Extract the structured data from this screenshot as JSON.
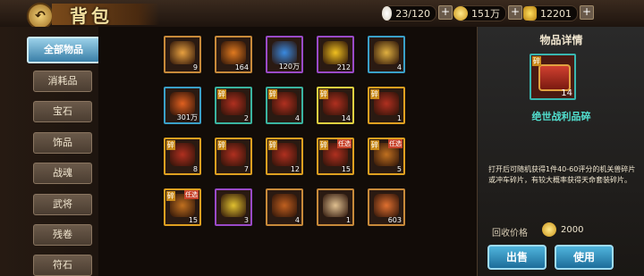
{
  "header": {
    "back_icon": "back-arrow-icon",
    "title": "背包"
  },
  "resources": [
    {
      "name": "rice",
      "icon": "rice-icon",
      "value": "23/120"
    },
    {
      "name": "coin",
      "icon": "coin-icon",
      "value": "151万"
    },
    {
      "name": "gold",
      "icon": "gold-ingot-icon",
      "value": "12201"
    }
  ],
  "plus_label": "+",
  "sidebar": {
    "items": [
      {
        "label": "全部物品",
        "active": true
      },
      {
        "label": "消耗品"
      },
      {
        "label": "宝石"
      },
      {
        "label": "饰品"
      },
      {
        "label": "战魂"
      },
      {
        "label": "武将"
      },
      {
        "label": "残卷"
      },
      {
        "label": "符石"
      }
    ]
  },
  "inventory": [
    {
      "icon": "gem-crystal-icon",
      "count": "9",
      "frame": "#c88a3a",
      "color": "#e7a040"
    },
    {
      "icon": "orange-orb-icon",
      "count": "164",
      "frame": "#c88a3a",
      "color": "#e07a20"
    },
    {
      "icon": "blue-gem-icon",
      "count": "120万",
      "frame": "#9a4ac8",
      "color": "#3a8ae0"
    },
    {
      "icon": "gold-coin-icon",
      "count": "212",
      "frame": "#9a4ac8",
      "color": "#f0c020"
    },
    {
      "icon": "talisman-icon",
      "count": "4",
      "frame": "#3aa0c8",
      "color": "#e0b040"
    },
    {
      "icon": "red-scroll-icon",
      "count": "301万",
      "frame": "#3aa0c8",
      "color": "#e06020"
    },
    {
      "icon": "chest-icon",
      "count": "2",
      "frame": "#3ab4a0",
      "color": "#b03020",
      "frag": "碎"
    },
    {
      "icon": "chest-icon",
      "count": "4",
      "frame": "#3ab4a0",
      "color": "#b03020",
      "frag": "碎"
    },
    {
      "icon": "chest-icon",
      "count": "14",
      "frame": "#e0d040",
      "color": "#b03020",
      "frag": "碎"
    },
    {
      "icon": "chest-icon",
      "count": "1",
      "frame": "#e0a020",
      "color": "#b03020",
      "frag": "碎"
    },
    {
      "icon": "chest-icon",
      "count": "8",
      "frame": "#e0a020",
      "color": "#b03020",
      "frag": "碎"
    },
    {
      "icon": "chest-icon",
      "count": "7",
      "frame": "#e0a020",
      "color": "#b03020",
      "frag": "碎"
    },
    {
      "icon": "chest-icon",
      "count": "12",
      "frame": "#e0a020",
      "color": "#b03020",
      "frag": "碎"
    },
    {
      "icon": "chest-icon",
      "count": "15",
      "frame": "#e0a020",
      "color": "#b03020",
      "frag": "碎",
      "tag": "任选"
    },
    {
      "icon": "chest-icon",
      "count": "5",
      "frame": "#e0a020",
      "color": "#c07020",
      "frag": "碎",
      "tag": "任选"
    },
    {
      "icon": "chest-icon",
      "count": "15",
      "frame": "#e0a020",
      "color": "#c07020",
      "frag": "碎",
      "tag": "任选"
    },
    {
      "icon": "grain-bundle-icon",
      "count": "3",
      "frame": "#9a4ac8",
      "color": "#e0c030"
    },
    {
      "icon": "treasure-bag-icon",
      "count": "4",
      "frame": "#c88a3a",
      "color": "#c06020"
    },
    {
      "icon": "scroll-icon",
      "count": "1",
      "frame": "#c88a3a",
      "color": "#e0c090"
    },
    {
      "icon": "armor-icon",
      "count": "603",
      "frame": "#c88a3a",
      "color": "#e07030"
    }
  ],
  "detail": {
    "title": "物品详情",
    "icon": "chest-icon",
    "frag": "碎",
    "count": "14",
    "name": "绝世战利品碎",
    "desc": "打开后可随机获得1件40-60评分的机关兽碎片或冲车碎片，有较大概率获得天命套装碎片。",
    "price_label": "回收价格",
    "price_icon": "coin-icon",
    "price": "2000",
    "sell_label": "出售",
    "use_label": "使用"
  }
}
